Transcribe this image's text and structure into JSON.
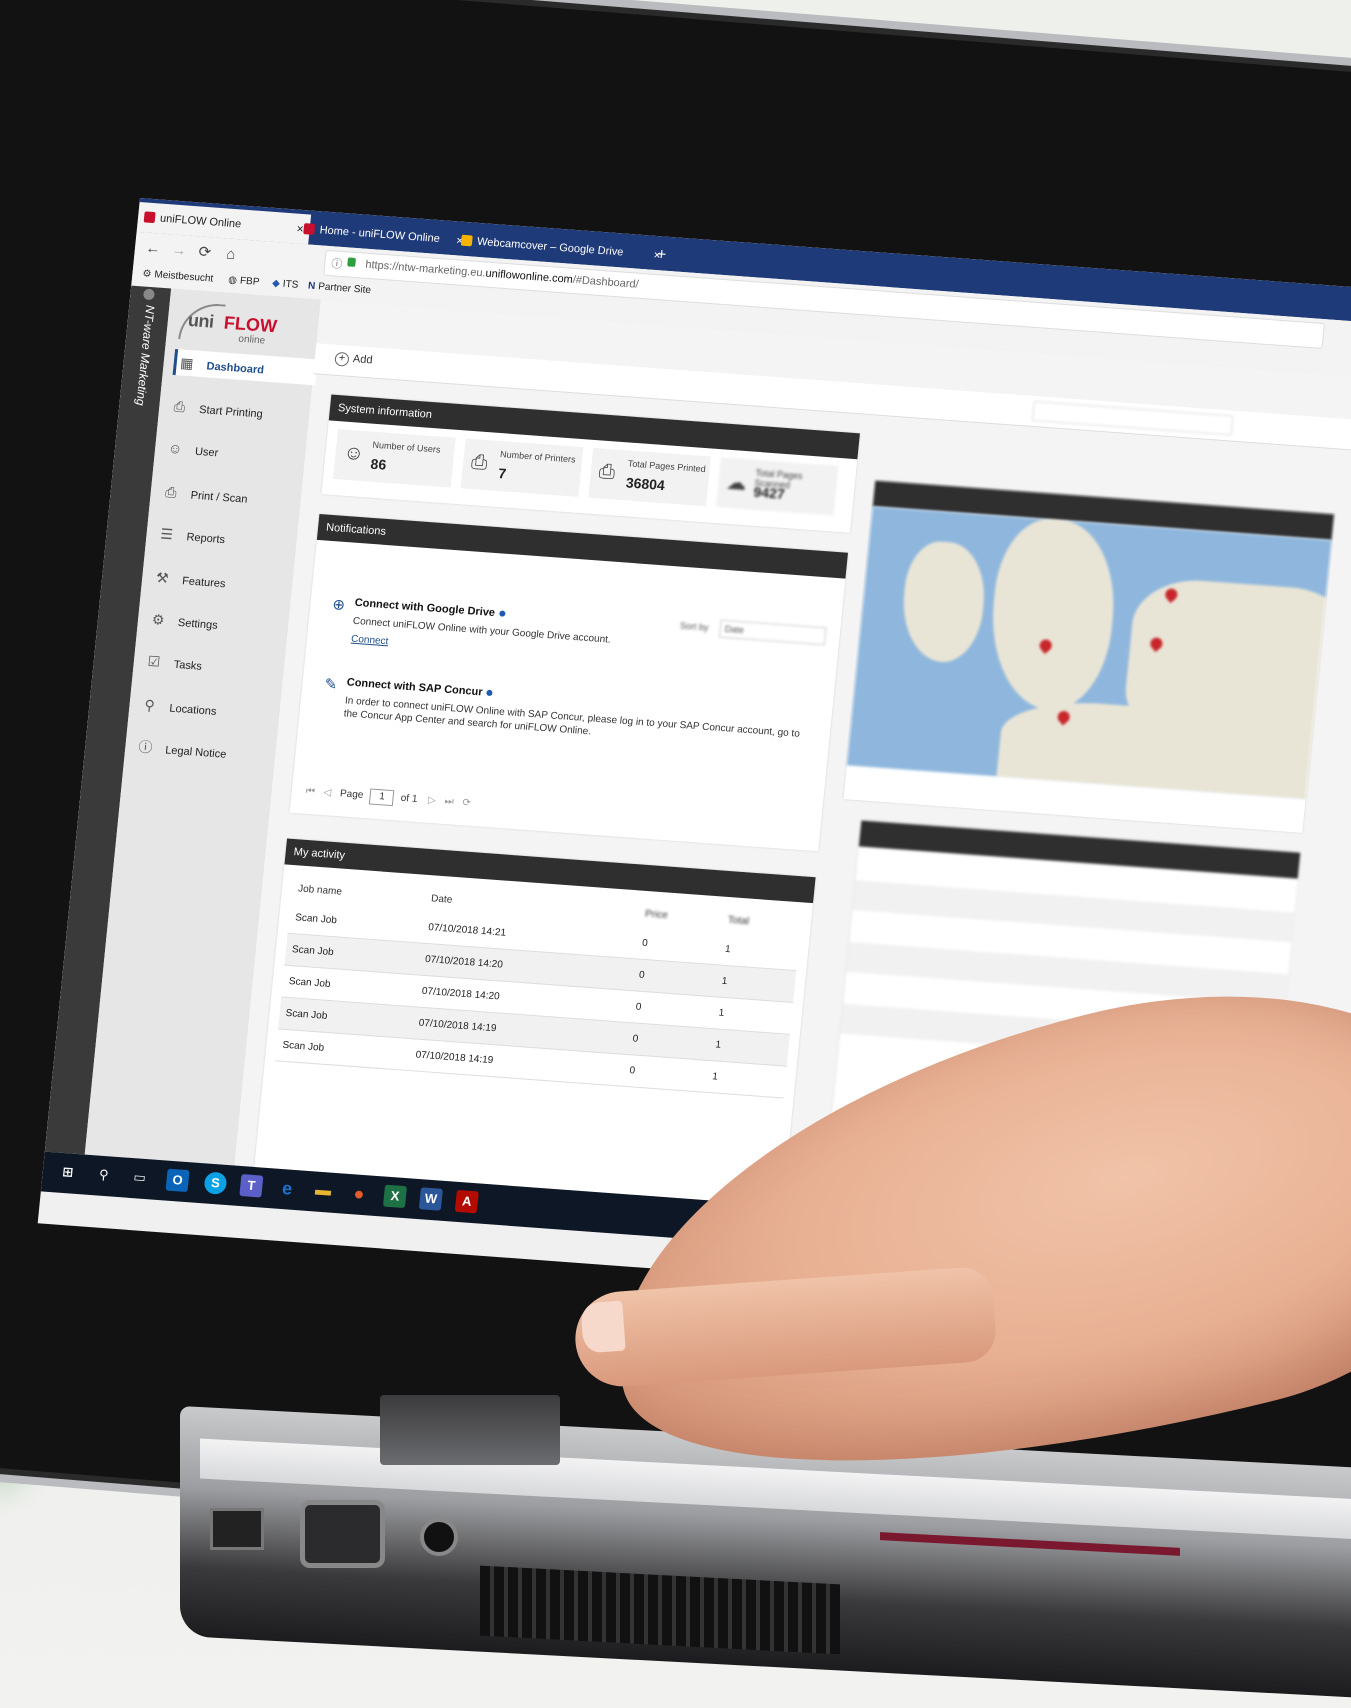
{
  "browser": {
    "tabs": [
      {
        "label": "uniFLOW Online",
        "close": "×",
        "active": true
      },
      {
        "label": "Home - uniFLOW Online",
        "close": "×",
        "active": false
      },
      {
        "label": "Webcamcover – Google Drive",
        "close": "×",
        "active": false
      }
    ],
    "new_tab": "+",
    "nav": {
      "back": "←",
      "forward": "→",
      "reload": "⟳",
      "home": "⌂"
    },
    "url_prefix": "https://ntw-marketing.eu.",
    "url_domain": "uniflowonline.com",
    "url_suffix": "/#Dashboard/",
    "bookmarks": [
      "Meistbesucht",
      "FBP",
      "ITS",
      "Partner Site"
    ]
  },
  "app": {
    "side_label": "NT-ware Marketing",
    "logo": {
      "uni": "uni",
      "flow": "FLOW",
      "online": "online"
    },
    "nav": [
      {
        "label": "Dashboard",
        "icon": "dashboard-icon",
        "glyph": "▦"
      },
      {
        "label": "Start Printing",
        "icon": "printer-icon",
        "glyph": "⎙"
      },
      {
        "label": "User",
        "icon": "user-icon",
        "glyph": "☺"
      },
      {
        "label": "Print / Scan",
        "icon": "print-scan-icon",
        "glyph": "⎙"
      },
      {
        "label": "Reports",
        "icon": "reports-icon",
        "glyph": "☰"
      },
      {
        "label": "Features",
        "icon": "features-icon",
        "glyph": "⚒"
      },
      {
        "label": "Settings",
        "icon": "gear-icon",
        "glyph": "⚙"
      },
      {
        "label": "Tasks",
        "icon": "tasks-icon",
        "glyph": "☑"
      },
      {
        "label": "Locations",
        "icon": "location-pin-icon",
        "glyph": "⚲"
      },
      {
        "label": "Legal Notice",
        "icon": "info-icon",
        "glyph": "ⓘ"
      }
    ],
    "add_label": "Add",
    "add_glyph": "+",
    "system_info": {
      "title": "System information",
      "stats": [
        {
          "label": "Number of Users",
          "value": "86",
          "glyph": "☺"
        },
        {
          "label": "Number of Printers",
          "value": "7",
          "glyph": "⎙"
        },
        {
          "label": "Total Pages Printed",
          "value": "36804",
          "glyph": "⎙"
        },
        {
          "label": "Total Pages Scanned",
          "value": "9427",
          "glyph": "☁"
        }
      ]
    },
    "notifications": {
      "title": "Notifications",
      "sort_label": "Sort by",
      "sort_value": "Date",
      "items": [
        {
          "title": "Connect with Google Drive",
          "text": "Connect uniFLOW Online with your Google Drive account.",
          "link": "Connect",
          "glyph": "⊕"
        },
        {
          "title": "Connect with SAP Concur",
          "text": "In order to connect uniFLOW Online with SAP Concur, please log in to your SAP Concur account, go to the Concur App Center and search for uniFLOW Online.",
          "glyph": "✎"
        }
      ],
      "pager": {
        "page_label": "Page",
        "page": "1",
        "of": "of 1",
        "first": "⏮",
        "prev": "◁",
        "next": "▷",
        "last": "⏭",
        "refresh": "⟳"
      }
    },
    "activity": {
      "title": "My activity",
      "columns": [
        "Job name",
        "Date",
        "Price",
        "Total"
      ],
      "rows": [
        {
          "job": "Scan Job",
          "date": "07/10/2018 14:21",
          "price": "0",
          "total": "1"
        },
        {
          "job": "Scan Job",
          "date": "07/10/2018 14:20",
          "price": "0",
          "total": "1"
        },
        {
          "job": "Scan Job",
          "date": "07/10/2018 14:20",
          "price": "0",
          "total": "1"
        },
        {
          "job": "Scan Job",
          "date": "07/10/2018 14:19",
          "price": "0",
          "total": "1"
        },
        {
          "job": "Scan Job",
          "date": "07/10/2018 14:19",
          "price": "0",
          "total": "1"
        }
      ]
    }
  },
  "taskbar": {
    "items": [
      {
        "name": "windows-start-icon",
        "glyph": "⊞",
        "color": "#0e1726"
      },
      {
        "name": "search-icon",
        "glyph": "⚲",
        "color": "#0e1726"
      },
      {
        "name": "task-view-icon",
        "glyph": "▭",
        "color": "#0e1726"
      },
      {
        "name": "outlook-icon",
        "glyph": "O",
        "color": "#0a64b7"
      },
      {
        "name": "skype-icon",
        "glyph": "S",
        "color": "#0aa1e6"
      },
      {
        "name": "teams-icon",
        "glyph": "T",
        "color": "#5b5fc7"
      },
      {
        "name": "edge-icon",
        "glyph": "e",
        "color": "#1b74d1"
      },
      {
        "name": "explorer-icon",
        "glyph": "▬",
        "color": "#e8b633"
      },
      {
        "name": "firefox-icon",
        "glyph": "●",
        "color": "#e55b2a"
      },
      {
        "name": "excel-icon",
        "glyph": "X",
        "color": "#1e7145"
      },
      {
        "name": "word-icon",
        "glyph": "W",
        "color": "#2b579a"
      },
      {
        "name": "acrobat-icon",
        "glyph": "A",
        "color": "#b30b00"
      }
    ]
  }
}
